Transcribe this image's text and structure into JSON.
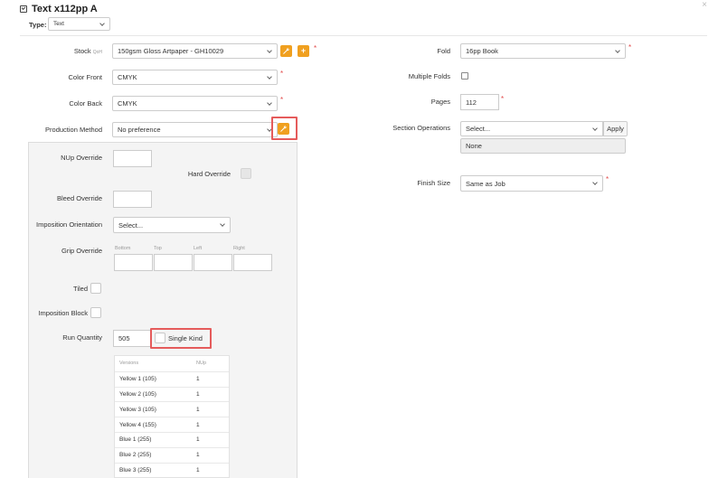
{
  "header": {
    "title": "Text x112pp A",
    "title_icon": "checkbox-edit-icon",
    "close_glyph": "×"
  },
  "type_field": {
    "label": "Type:",
    "value": "Text"
  },
  "left": {
    "stock": {
      "label": "Stock",
      "sub": "QoH",
      "value": "150gsm Gloss Artpaper - GH10029",
      "required": "*"
    },
    "color_front": {
      "label": "Color Front",
      "value": "CMYK",
      "required": "*"
    },
    "color_back": {
      "label": "Color Back",
      "value": "CMYK",
      "required": "*"
    },
    "production_method": {
      "label": "Production Method",
      "value": "No preference"
    },
    "nup_override": {
      "label": "NUp Override",
      "value": ""
    },
    "hard_override": {
      "label": "Hard Override"
    },
    "bleed_override": {
      "label": "Bleed Override",
      "value": ""
    },
    "imposition_orientation": {
      "label": "Imposition Orientation",
      "value": "Select..."
    },
    "grip_override": {
      "label": "Grip Override",
      "bottom": "Bottom",
      "top": "Top",
      "left": "Left",
      "right": "Right"
    },
    "tiled": {
      "label": "Tiled"
    },
    "imposition_block": {
      "label": "Imposition Block"
    },
    "run_quantity": {
      "label": "Run Quantity",
      "value": "505",
      "single_kind": "Single Kind"
    },
    "versions_table": {
      "headers": [
        "Versions",
        "NUp"
      ],
      "rows": [
        [
          "Yellow 1 (105)",
          "1"
        ],
        [
          "Yellow 2 (105)",
          "1"
        ],
        [
          "Yellow 3 (105)",
          "1"
        ],
        [
          "Yellow 4 (155)",
          "1"
        ],
        [
          "Blue 1 (255)",
          "1"
        ],
        [
          "Blue 2 (255)",
          "1"
        ],
        [
          "Blue 3 (255)",
          "1"
        ]
      ]
    }
  },
  "right": {
    "fold": {
      "label": "Fold",
      "value": "16pp Book",
      "required": "*"
    },
    "multiple_folds": {
      "label": "Multiple Folds"
    },
    "pages": {
      "label": "Pages",
      "value": "112",
      "required": "*"
    },
    "section_operations": {
      "label": "Section Operations",
      "value": "Select...",
      "apply": "Apply",
      "selected": "None"
    },
    "finish_size": {
      "label": "Finish Size",
      "value": "Same as Job",
      "required": "*"
    }
  },
  "colors": {
    "accent_orange": "#f0a020",
    "required_red": "#e24b4b",
    "highlight_red": "#e55b5b"
  }
}
